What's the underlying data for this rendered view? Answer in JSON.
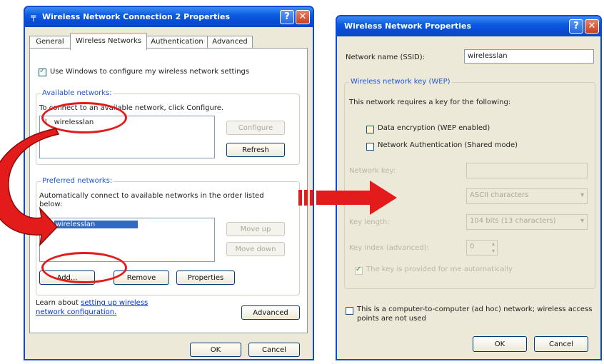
{
  "left_dialog": {
    "title": "Wireless Network Connection 2 Properties",
    "help_glyph": "?",
    "close_glyph": "✕",
    "tabs": [
      "General",
      "Wireless Networks",
      "Authentication",
      "Advanced"
    ],
    "use_windows_label": "Use Windows to configure my wireless network settings",
    "available": {
      "group_label": "Available networks:",
      "instruction": "To connect to an available network, click Configure.",
      "items": [
        "wirelesslan"
      ],
      "configure_label": "Configure",
      "refresh_label": "Refresh"
    },
    "preferred": {
      "group_label": "Preferred networks:",
      "instruction": "Automatically connect to available networks in the order listed below:",
      "items": [
        "wirelesslan"
      ],
      "move_up_label": "Move up",
      "move_down_label": "Move down"
    },
    "add_label": "Add...",
    "remove_label": "Remove",
    "properties_label": "Properties",
    "learn_prefix": "Learn about ",
    "learn_link": "setting up wireless network configuration.",
    "advanced_label": "Advanced",
    "ok_label": "OK",
    "cancel_label": "Cancel"
  },
  "right_dialog": {
    "title": "Wireless Network Properties",
    "help_glyph": "?",
    "close_glyph": "✕",
    "ssid_label": "Network name (SSID):",
    "ssid_value": "wirelesslan",
    "wep_group_label": "Wireless network key (WEP)",
    "requires_key_text": "This network requires a key for the following:",
    "data_encryption_label": "Data encryption (WEP enabled)",
    "network_auth_label": "Network Authentication (Shared mode)",
    "network_key_label": "Network key:",
    "key_format_value": "ASCII characters",
    "key_length_label": "Key length:",
    "key_length_value": "104 bits (13 characters)",
    "key_index_label": "Key index (advanced):",
    "key_index_value": "0",
    "key_provided_label": "The key is provided for me automatically",
    "adhoc_label": "This is a computer-to-computer (ad hoc) network; wireless access points are not used",
    "ok_label": "OK",
    "cancel_label": "Cancel"
  },
  "annotation_colors": {
    "highlight": "#e31b1b",
    "arrow": "#e31b1b"
  }
}
